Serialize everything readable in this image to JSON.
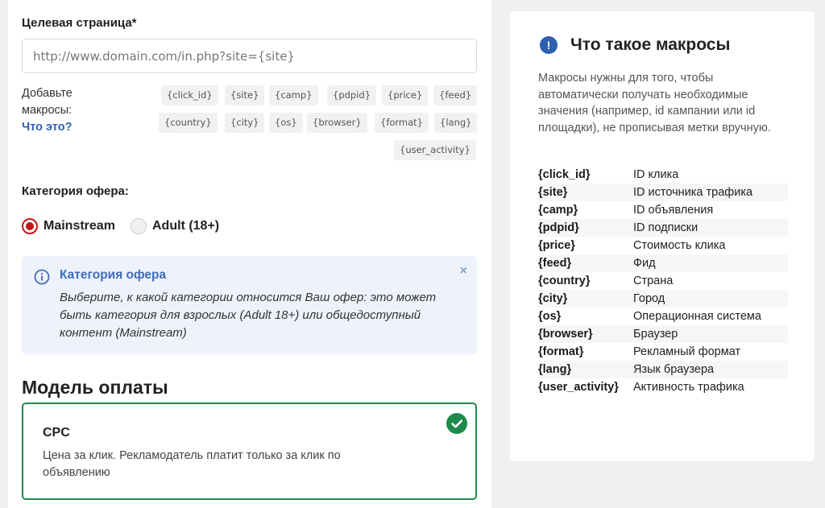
{
  "target_page": {
    "label": "Целевая страница*",
    "placeholder": "http://www.domain.com/in.php?site={site}"
  },
  "macros": {
    "label": "Добавьте макросы:",
    "link": "Что это?",
    "chips": [
      "{click_id}",
      "{site}",
      "{camp}",
      "{pdpid}",
      "{price}",
      "{feed}",
      "{country}",
      "{city}",
      "{os}",
      "{browser}",
      "{format}",
      "{lang}",
      "{user_activity}"
    ]
  },
  "category": {
    "label": "Категория офера:",
    "options": [
      "Mainstream",
      "Adult (18+)"
    ],
    "selected": "Mainstream"
  },
  "info": {
    "title": "Категория офера",
    "text": "Выберите, к какой категории относится Ваш офер: это может быть категория для взрослых (Adult 18+) или общедоступный контент (Mainstream)",
    "close": "×"
  },
  "payment": {
    "title": "Модель оплаты",
    "card_title": "CPC",
    "card_desc": "Цена за клик. Рекламодатель платит только за клик по объявлению"
  },
  "help": {
    "icon": "!",
    "title": "Что такое макросы",
    "description": "Макросы нужны для того, чтобы автоматически получать необходимые значения (например, id кампании или id площадки), не прописывая метки вручную.",
    "rows": [
      {
        "key": "{click_id}",
        "value": "ID клика"
      },
      {
        "key": "{site}",
        "value": "ID источника трафика"
      },
      {
        "key": "{camp}",
        "value": "ID объявления"
      },
      {
        "key": "{pdpid}",
        "value": "ID подписки"
      },
      {
        "key": "{price}",
        "value": "Стоимость клика"
      },
      {
        "key": "{feed}",
        "value": "Фид"
      },
      {
        "key": "{country}",
        "value": "Страна"
      },
      {
        "key": "{city}",
        "value": "Город"
      },
      {
        "key": "{os}",
        "value": "Операционная система"
      },
      {
        "key": "{browser}",
        "value": "Браузер"
      },
      {
        "key": "{format}",
        "value": "Рекламный формат"
      },
      {
        "key": "{lang}",
        "value": "Язык браузера"
      },
      {
        "key": "{user_activity}",
        "value": "Активность трафика"
      }
    ]
  },
  "colors": {
    "accent_blue": "#2f5fb0",
    "radio_red": "#c0141a",
    "success_green": "#1e8a4c",
    "info_bg": "#eef2fa"
  }
}
